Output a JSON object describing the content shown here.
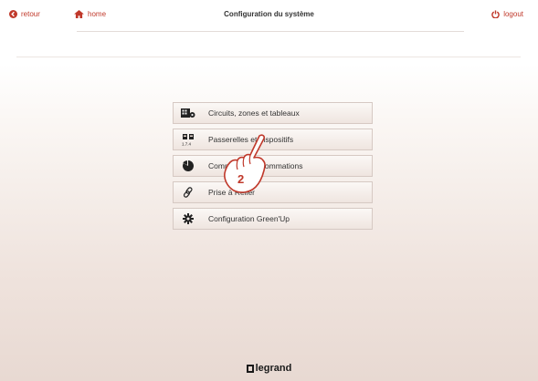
{
  "header": {
    "back_label": "retour",
    "home_label": "home",
    "title": "Configuration du système",
    "logout_label": "logout"
  },
  "menu": {
    "items": [
      {
        "label": "Circuits, zones et tableaux",
        "icon": "circuit-board-icon"
      },
      {
        "label": "Passerelles et dispositifs",
        "icon": "devices-icon"
      },
      {
        "label": "Compteurs consommations",
        "icon": "pie-chart-icon"
      },
      {
        "label": "Prise à Relier",
        "icon": "link-icon"
      },
      {
        "label": "Configuration Green'Up",
        "icon": "gear-icon"
      }
    ]
  },
  "overlay": {
    "step_number": "2"
  },
  "footer": {
    "brand": "legrand"
  },
  "colors": {
    "accent": "#c0392b",
    "text": "#333333",
    "background_bottom": "#e8d9d2"
  }
}
